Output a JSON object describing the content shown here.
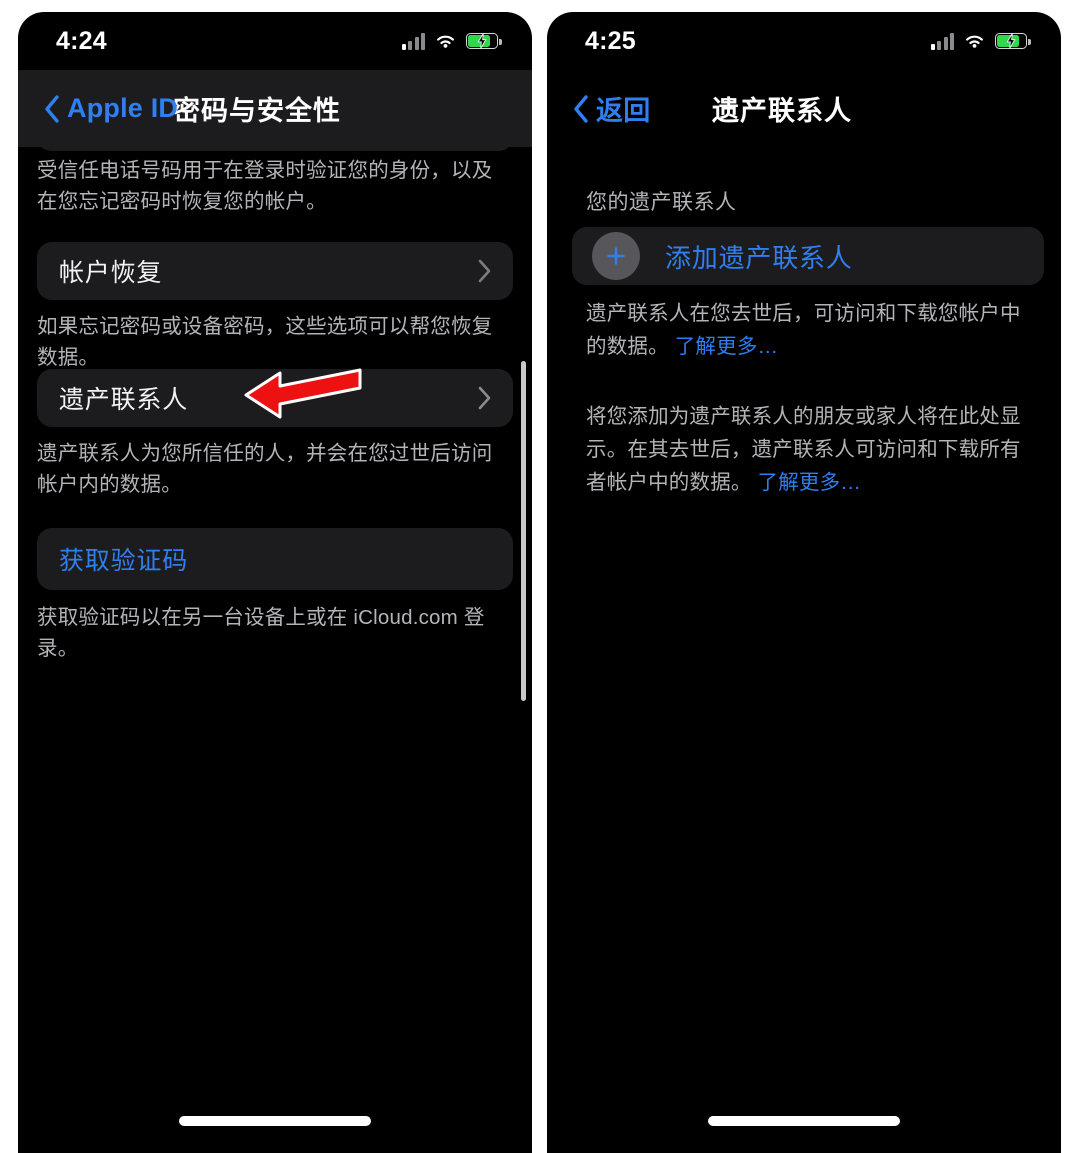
{
  "left_screen": {
    "status_bar": {
      "time": "4:24",
      "signal_icon": "cellular-signal-icon",
      "wifi_icon": "wifi-icon",
      "battery_icon": "battery-charging-icon",
      "signal_bars_active": 1,
      "signal_bars_total": 4,
      "battery_color": "#32d74b"
    },
    "nav": {
      "back_label": "Apple ID",
      "back_icon": "chevron-left-icon",
      "title": "密码与安全性"
    },
    "footnotes": {
      "trusted_phone": "受信任电话号码用于在登录时验证您的身份，以及在您忘记密码时恢复您的帐户。",
      "account_recovery": "如果忘记密码或设备密码，这些选项可以帮您恢复数据。",
      "legacy_contact": "遗产联系人为您所信任的人，并会在您过世后访问帐户内的数据。",
      "verification_code": "获取验证码以在另一台设备上或在 iCloud.com 登录。"
    },
    "rows": [
      {
        "label": "帐户恢复",
        "chevron": "chevron-right-icon"
      },
      {
        "label": "遗产联系人",
        "chevron": "chevron-right-icon"
      },
      {
        "label": "获取验证码",
        "chevron": ""
      }
    ],
    "annotation": {
      "type": "arrow",
      "direction": "left",
      "color": "#ee1111",
      "outline_color": "#ffffff",
      "points_at": "遗产联系人"
    },
    "home_indicator": "home-indicator"
  },
  "right_screen": {
    "status_bar": {
      "time": "4:25",
      "signal_icon": "cellular-signal-icon",
      "wifi_icon": "wifi-icon",
      "battery_icon": "battery-charging-icon",
      "signal_bars_active": 1,
      "signal_bars_total": 4,
      "battery_color": "#32d74b"
    },
    "nav": {
      "back_label": "返回",
      "back_icon": "chevron-left-icon",
      "title": "遗产联系人"
    },
    "group_header": "您的遗产联系人",
    "add_button": {
      "label": "添加遗产联系人",
      "icon": "plus-icon"
    },
    "paragraph_1": {
      "text": "遗产联系人在您去世后，可访问和下载您帐户中的数据。",
      "link": "了解更多…"
    },
    "paragraph_2": {
      "text": "将您添加为遗产联系人的朋友或家人将在此处显示。在其去世后，遗产联系人可访问和下载所有者帐户中的数据。",
      "link": "了解更多…"
    },
    "home_indicator": "home-indicator"
  },
  "theme": {
    "background": "#000000",
    "card": "#1c1c1e",
    "accent_blue": "#2f7ff0",
    "text_primary": "#f2f2f2",
    "text_secondary": "#b4b4b8"
  }
}
